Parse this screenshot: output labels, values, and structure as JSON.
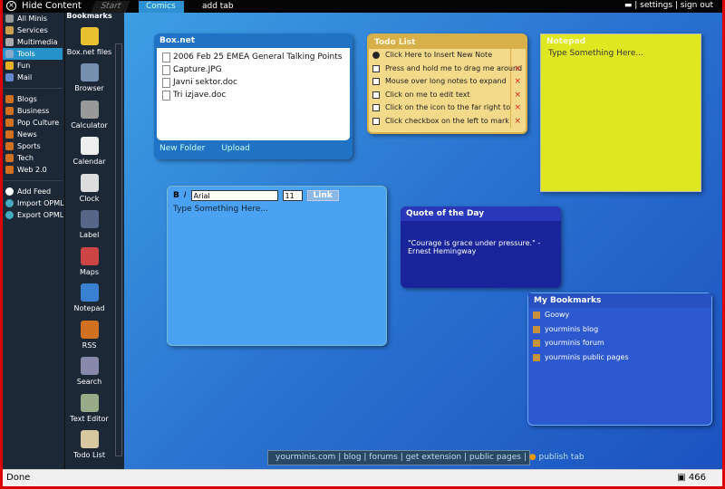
{
  "topbar": {
    "hide": "Hide Content",
    "tabs": [
      "Start",
      "Comics"
    ],
    "add_tab": "add tab",
    "settings": "settings",
    "signout": "sign out"
  },
  "categories": [
    "All Minis",
    "Services",
    "Multimedia",
    "Tools",
    "Fun",
    "Mail"
  ],
  "feeds": [
    "Blogs",
    "Business",
    "Pop Culture",
    "News",
    "Sports",
    "Tech",
    "Web 2.0"
  ],
  "feed_actions": [
    "Add Feed",
    "Import OPML",
    "Export OPML"
  ],
  "minis_header": "Bookmarks",
  "minis": [
    "Box.net files",
    "Browser",
    "Calculator",
    "Calendar",
    "Clock",
    "Label",
    "Maps",
    "Notepad",
    "RSS",
    "Search",
    "Text Editor",
    "Todo List"
  ],
  "boxnet": {
    "title": "Box.net",
    "files": [
      "2006 Feb 25 EMEA General Talking Points ...",
      "Capture.JPG",
      "Javni sektor.doc",
      "Tri izjave.doc"
    ],
    "new_folder": "New Folder",
    "upload": "Upload"
  },
  "editor": {
    "bold": "B",
    "italic": "I",
    "font": "Arial",
    "size": "11",
    "link": "Link",
    "text": "Type Something Here..."
  },
  "todo": {
    "title": "Todo List",
    "insert": "Click Here to Insert New Note",
    "items": [
      "Press and hold me to drag me around",
      "Mouse over long notes to expand",
      "Click on me to edit text",
      "Click on the icon to the far right to",
      "Click checkbox on the left to mark"
    ]
  },
  "notepad": {
    "title": "Notepad",
    "text": "Type Something Here..."
  },
  "quote": {
    "title": "Quote of the Day",
    "text": "\"Courage is grace under pressure.\" - Ernest Hemingway"
  },
  "bookmarks": {
    "title": "My Bookmarks",
    "items": [
      "Goowy",
      "yourminis blog",
      "yourminis forum",
      "yourminis public pages"
    ]
  },
  "footer": [
    "yourminis.com",
    "blog",
    "forums",
    "get extension",
    "public pages",
    "publish tab"
  ],
  "status": {
    "text": "Done",
    "count": "466"
  },
  "colors": {
    "accent": "#2592c9",
    "todo": "#f3d98a",
    "notepad": "#dfe720",
    "quote": "#19249a"
  }
}
